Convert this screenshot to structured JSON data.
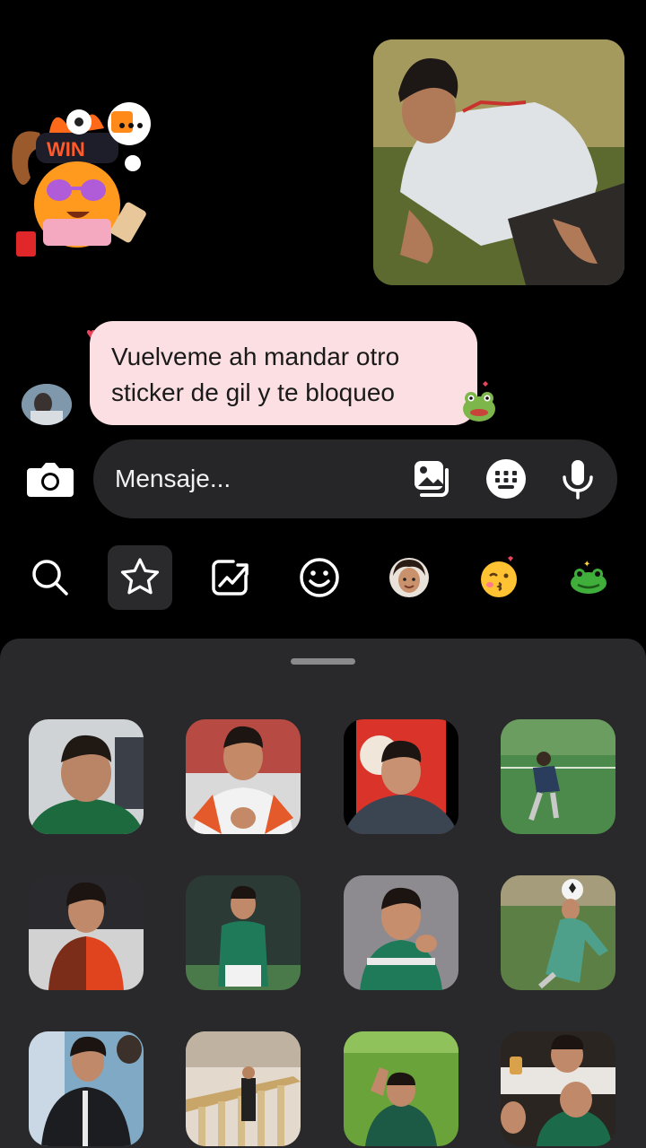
{
  "chat": {
    "message_text": "Vuelveme ah mandar otro\nsticker  de gil y te bloqueo"
  },
  "composer": {
    "placeholder": "Mensaje..."
  },
  "colors": {
    "bubble": "#fbdfe3",
    "composer": "#262628",
    "sheet": "#29292b"
  },
  "icons": {
    "camera": "camera-icon",
    "gallery": "gallery-icon",
    "keyboard": "keyboard-icon",
    "microphone": "microphone-icon"
  },
  "tabs": [
    {
      "icon": "search-icon",
      "active": false
    },
    {
      "icon": "star-icon",
      "active": true
    },
    {
      "icon": "trending-icon",
      "active": false
    },
    {
      "icon": "emoji-icon",
      "active": false
    },
    {
      "icon": "avatar-sticker-icon",
      "active": false
    },
    {
      "icon": "kiss-emoji-icon",
      "active": false
    },
    {
      "icon": "frog-icon",
      "active": false
    }
  ]
}
